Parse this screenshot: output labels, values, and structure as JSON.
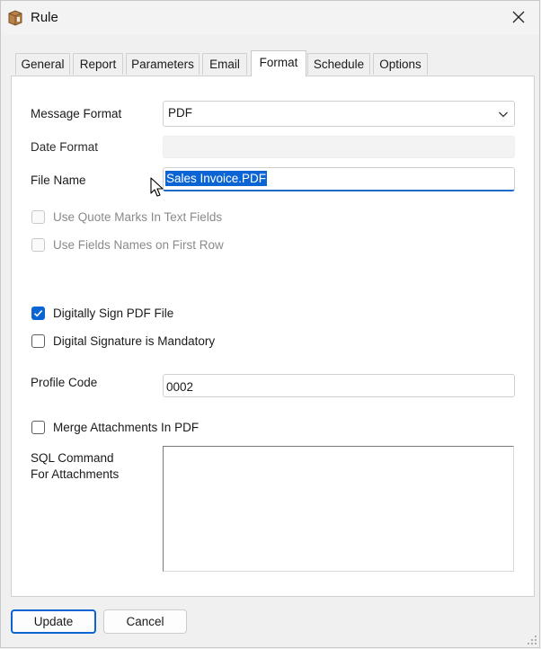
{
  "window": {
    "title": "Rule",
    "icon": "app-box-icon",
    "close_icon": "close-icon"
  },
  "tabs": [
    {
      "label": "General",
      "active": false
    },
    {
      "label": "Report",
      "active": false
    },
    {
      "label": "Parameters",
      "active": false
    },
    {
      "label": "Email",
      "active": false
    },
    {
      "label": "Format",
      "active": true
    },
    {
      "label": "Schedule",
      "active": false
    },
    {
      "label": "Options",
      "active": false
    }
  ],
  "form": {
    "message_format": {
      "label": "Message Format",
      "value": "PDF"
    },
    "date_format": {
      "label": "Date Format",
      "value": ""
    },
    "file_name": {
      "label": "File Name",
      "value": "Sales Invoice.PDF"
    },
    "use_quote_marks": {
      "label": "Use Quote Marks In Text Fields",
      "checked": false,
      "enabled": false
    },
    "use_field_names": {
      "label": "Use Fields Names on First Row",
      "checked": false,
      "enabled": false
    },
    "digitally_sign": {
      "label": "Digitally Sign PDF File",
      "checked": true,
      "enabled": true
    },
    "signature_mandatory": {
      "label": "Digital Signature is Mandatory",
      "checked": false,
      "enabled": true
    },
    "profile_code": {
      "label": "Profile Code",
      "value": "0002"
    },
    "merge_attachments": {
      "label": "Merge Attachments In PDF",
      "checked": false,
      "enabled": true
    },
    "sql_command": {
      "label_line1": "SQL Command",
      "label_line2": "For Attachments",
      "value": ""
    }
  },
  "buttons": {
    "update": "Update",
    "cancel": "Cancel"
  },
  "colors": {
    "accent": "#0a64d4",
    "disabled_text": "#2a2a2a"
  }
}
